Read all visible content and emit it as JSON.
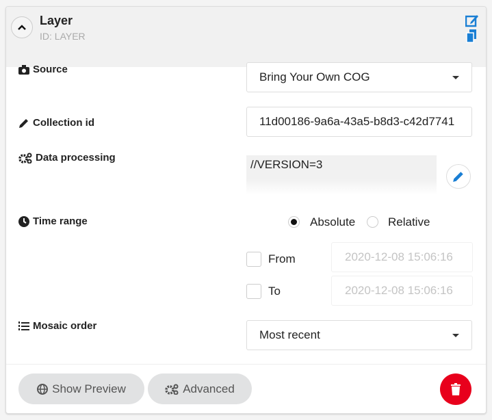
{
  "header": {
    "title": "Layer",
    "subtitle": "ID: LAYER"
  },
  "fields": {
    "source": {
      "label": "Source",
      "value": "Bring Your Own COG"
    },
    "collection": {
      "label": "Collection id",
      "value": "11d00186-9a6a-43a5-b8d3-c42d7741"
    },
    "processing": {
      "label": "Data processing",
      "value": "//VERSION=3"
    },
    "time": {
      "label": "Time range",
      "absolute": "Absolute",
      "relative": "Relative",
      "selected": "Absolute",
      "from_label": "From",
      "from_value": "2020-12-08 15:06:16",
      "from_checked": false,
      "to_label": "To",
      "to_value": "2020-12-08 15:06:16",
      "to_checked": false
    },
    "mosaic": {
      "label": "Mosaic order",
      "value": "Most recent"
    }
  },
  "footer": {
    "preview": "Show Preview",
    "advanced": "Advanced"
  },
  "colors": {
    "accent": "#1a7fd4",
    "danger": "#e8001c"
  }
}
